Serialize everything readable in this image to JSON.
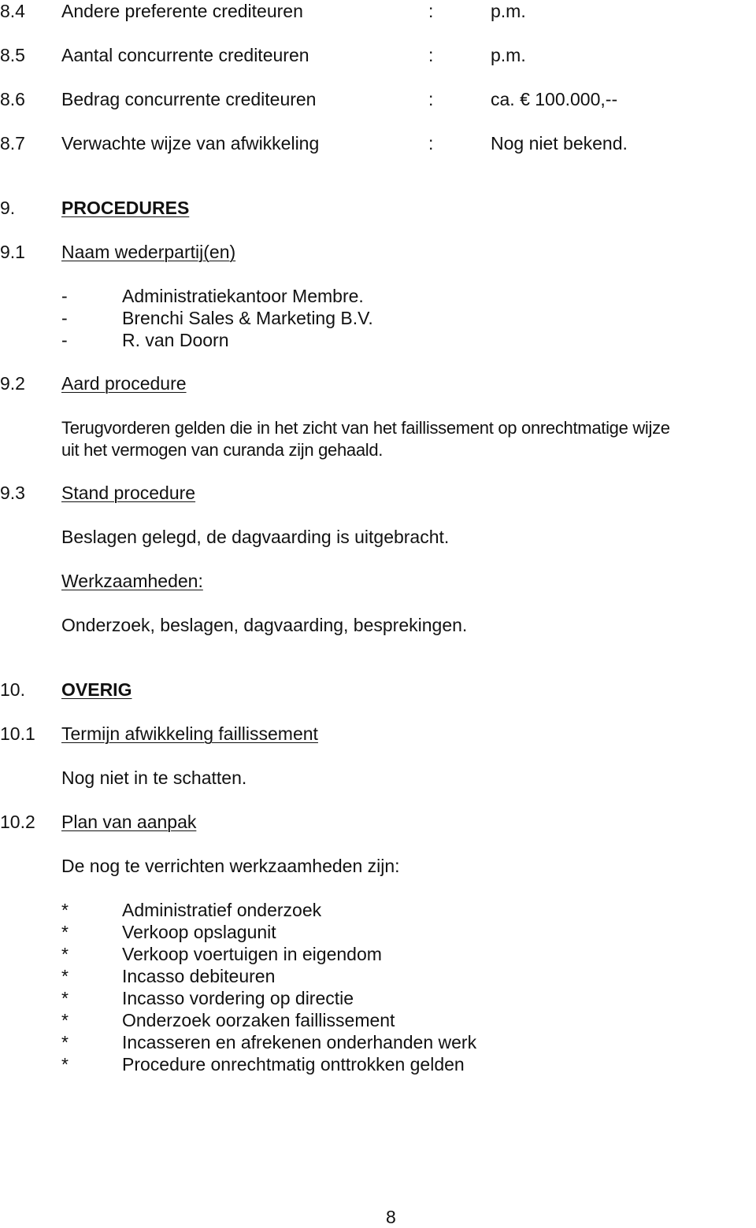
{
  "section8_items": [
    {
      "num": "8.4",
      "label": "Andere preferente crediteuren",
      "sep": ":",
      "value": "p.m."
    },
    {
      "num": "8.5",
      "label": "Aantal concurrente crediteuren",
      "sep": ":",
      "value": "p.m."
    },
    {
      "num": "8.6",
      "label": "Bedrag concurrente crediteuren",
      "sep": ":",
      "value": "ca. € 100.000,--"
    },
    {
      "num": "8.7",
      "label": "Verwachte wijze van afwikkeling",
      "sep": ":",
      "value": "Nog niet bekend."
    }
  ],
  "section9": {
    "num": "9.",
    "title": "PROCEDURES",
    "s91": {
      "num": "9.1",
      "title": "Naam wederpartij(en)",
      "dash": "-",
      "parties": [
        "Administratiekantoor Membre.",
        "Brenchi Sales & Marketing B.V.",
        "R. van Doorn"
      ]
    },
    "s92": {
      "num": "9.2",
      "title": "Aard procedure",
      "text_line1": "Terugvorderen gelden die in het zicht van het faillissement op onrechtmatige wijze",
      "text_line2": "uit het vermogen van curanda zijn gehaald."
    },
    "s93": {
      "num": "9.3",
      "title": "Stand procedure",
      "text": "Beslagen gelegd, de dagvaarding is uitgebracht.",
      "work_label": "Werkzaamheden:",
      "work_text": "Onderzoek, beslagen, dagvaarding, besprekingen."
    }
  },
  "section10": {
    "num": "10.",
    "title": "OVERIG",
    "s101": {
      "num": "10.1",
      "title": "Termijn afwikkeling faillissement",
      "text": "Nog niet in te schatten."
    },
    "s102": {
      "num": "10.2",
      "title": "Plan van aanpak",
      "intro": "De nog te verrichten werkzaamheden zijn:",
      "bullet": "*",
      "tasks": [
        "Administratief onderzoek",
        "Verkoop opslagunit",
        "Verkoop voertuigen in eigendom",
        "Incasso debiteuren",
        "Incasso vordering op directie",
        "Onderzoek oorzaken faillissement",
        "Incasseren en afrekenen onderhanden werk",
        "Procedure onrechtmatig onttrokken gelden"
      ]
    }
  },
  "page_number": "8"
}
